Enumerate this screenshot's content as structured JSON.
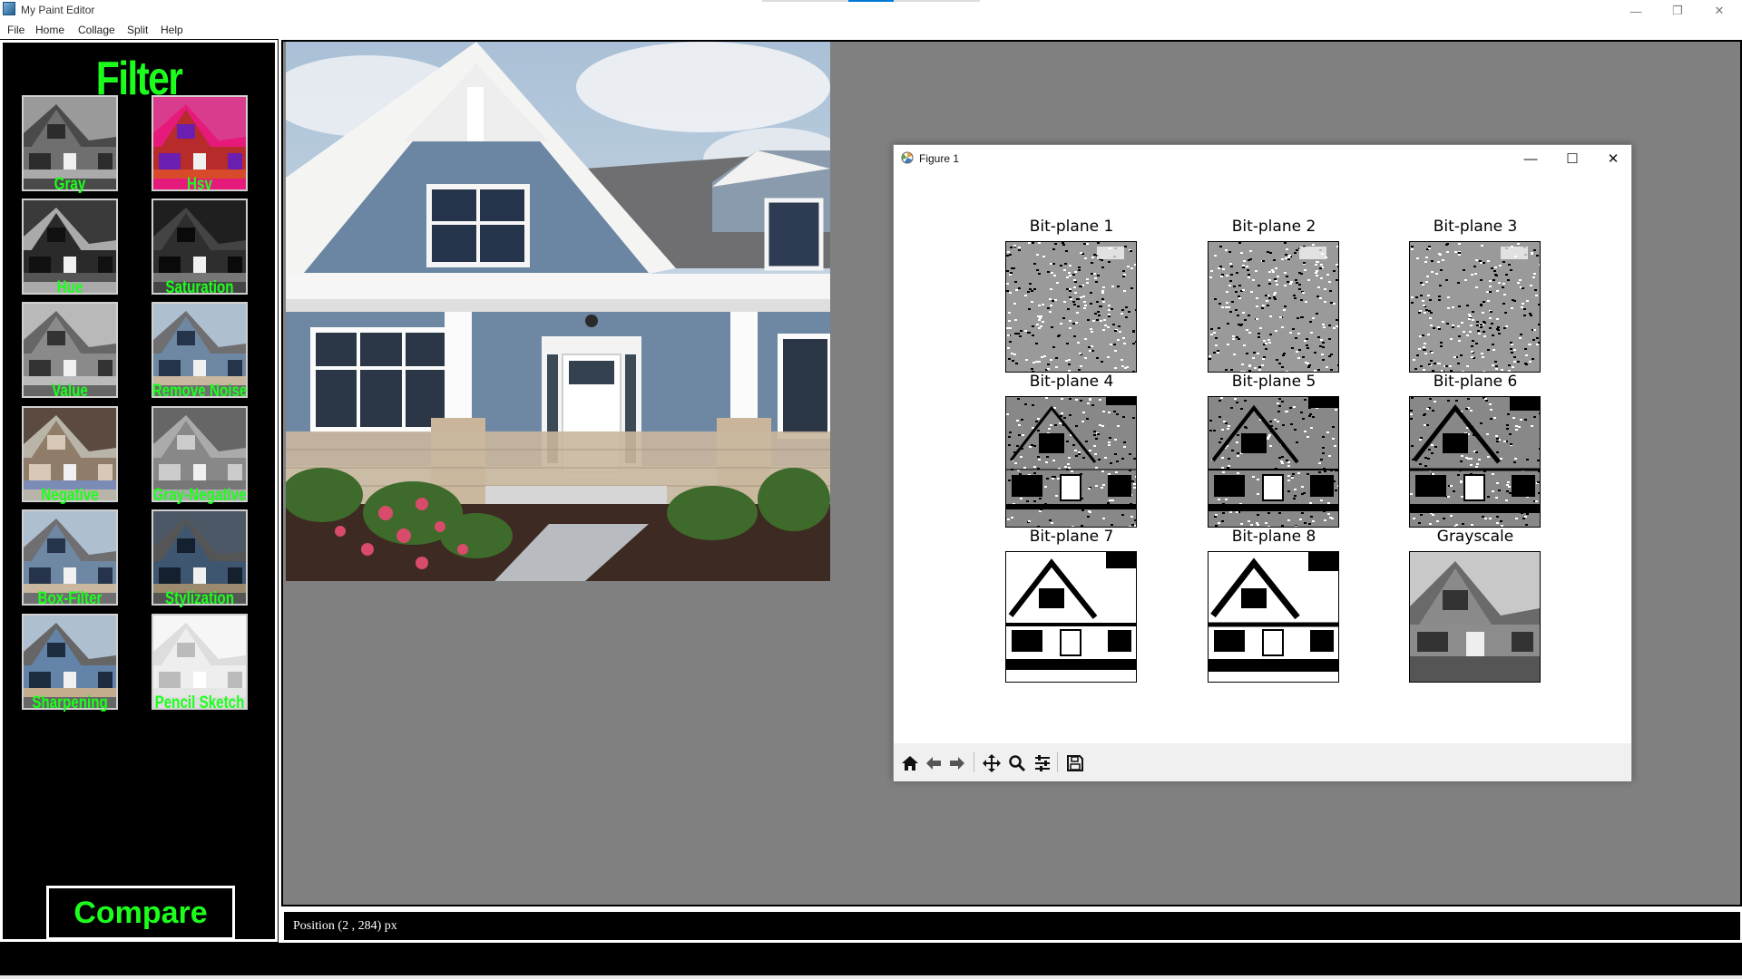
{
  "window": {
    "title": "My Paint Editor",
    "minimize": "—",
    "restore": "❐",
    "close": "✕"
  },
  "menu": {
    "items": [
      "File",
      "Home",
      "Collage",
      "Split",
      "Help"
    ]
  },
  "sidebar": {
    "title": "Filter",
    "filters": [
      {
        "label": "Gray"
      },
      {
        "label": "Hsv"
      },
      {
        "label": "Hue"
      },
      {
        "label": "Saturation"
      },
      {
        "label": "Value"
      },
      {
        "label": "Remove Noise"
      },
      {
        "label": "Negative"
      },
      {
        "label": "Gray-Negative"
      },
      {
        "label": "Box-Filter"
      },
      {
        "label": "Stylization"
      },
      {
        "label": "Sharpening"
      },
      {
        "label": "Pencil Sketch"
      }
    ],
    "compare_label": "Compare"
  },
  "status": {
    "position_text": "Position (2 , 284) px"
  },
  "figure": {
    "title": "Figure 1",
    "minimize": "—",
    "maximize": "☐",
    "close": "✕",
    "subplots": [
      {
        "title": "Bit-plane 1"
      },
      {
        "title": "Bit-plane 2"
      },
      {
        "title": "Bit-plane 3"
      },
      {
        "title": "Bit-plane 4"
      },
      {
        "title": "Bit-plane 5"
      },
      {
        "title": "Bit-plane 6"
      },
      {
        "title": "Bit-plane 7"
      },
      {
        "title": "Bit-plane 8"
      },
      {
        "title": "Grayscale"
      }
    ],
    "toolbar": [
      "home-icon",
      "back-arrow-icon",
      "forward-arrow-icon",
      "pan-icon",
      "zoom-icon",
      "configure-subplots-icon",
      "save-icon"
    ]
  },
  "colors": {
    "accent_green": "#1cff1c",
    "canvas_gray": "#808080",
    "sidebar_bg": "#000000"
  }
}
